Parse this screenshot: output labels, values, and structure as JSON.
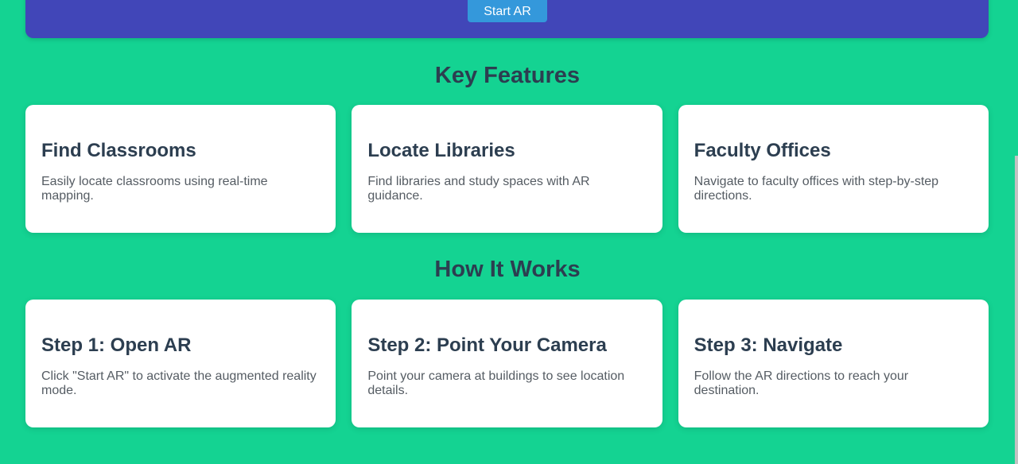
{
  "hero": {
    "start_button_label": "Start AR"
  },
  "features": {
    "title": "Key Features",
    "cards": [
      {
        "title": "Find Classrooms",
        "text": "Easily locate classrooms using real-time mapping."
      },
      {
        "title": "Locate Libraries",
        "text": "Find libraries and study spaces with AR guidance."
      },
      {
        "title": "Faculty Offices",
        "text": "Navigate to faculty offices with step-by-step directions."
      }
    ]
  },
  "how_it_works": {
    "title": "How It Works",
    "cards": [
      {
        "title": "Step 1: Open AR",
        "text": "Click \"Start AR\" to activate the augmented reality mode."
      },
      {
        "title": "Step 2: Point Your Camera",
        "text": "Point your camera at buildings to see location details."
      },
      {
        "title": "Step 3: Navigate",
        "text": "Follow the AR directions to reach your destination."
      }
    ]
  },
  "colors": {
    "background": "#14d392",
    "hero": "#4146b8",
    "button": "#3498db",
    "heading": "#2c3e50"
  }
}
